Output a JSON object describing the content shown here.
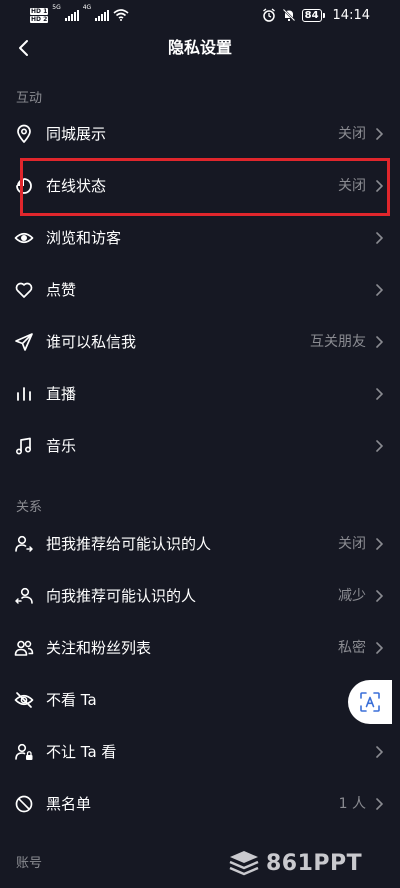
{
  "status_bar": {
    "hd1": "HD 1",
    "hd2": "HD 2",
    "net1": "5G",
    "net2": "4G",
    "battery": "84",
    "time": "14:14"
  },
  "header": {
    "title": "隐私设置"
  },
  "sections": {
    "interaction": "互动",
    "relationship": "关系",
    "account": "账号"
  },
  "rows": [
    {
      "label": "同城展示",
      "value": "关闭",
      "icon": "location-pin-icon"
    },
    {
      "label": "在线状态",
      "value": "关闭",
      "icon": "online-status-icon"
    },
    {
      "label": "浏览和访客",
      "value": "",
      "icon": "eye-icon"
    },
    {
      "label": "点赞",
      "value": "",
      "icon": "heart-icon"
    },
    {
      "label": "谁可以私信我",
      "value": "互关朋友",
      "icon": "paper-plane-icon"
    },
    {
      "label": "直播",
      "value": "",
      "icon": "live-bars-icon"
    },
    {
      "label": "音乐",
      "value": "",
      "icon": "music-note-icon"
    },
    {
      "label": "把我推荐给可能认识的人",
      "value": "关闭",
      "icon": "user-share-icon"
    },
    {
      "label": "向我推荐可能认识的人",
      "value": "减少",
      "icon": "user-recommend-icon"
    },
    {
      "label": "关注和粉丝列表",
      "value": "私密",
      "icon": "users-icon"
    },
    {
      "label": "不看 Ta",
      "value": "",
      "icon": "eye-off-icon"
    },
    {
      "label": "不让 Ta 看",
      "value": "",
      "icon": "user-lock-icon"
    },
    {
      "label": "黑名单",
      "value": "1 人",
      "icon": "block-icon"
    }
  ],
  "colors": {
    "background": "#161823",
    "secondary_text": "#8a8b91",
    "highlight": "#e0262c"
  },
  "watermark": {
    "text": "861PPT"
  }
}
